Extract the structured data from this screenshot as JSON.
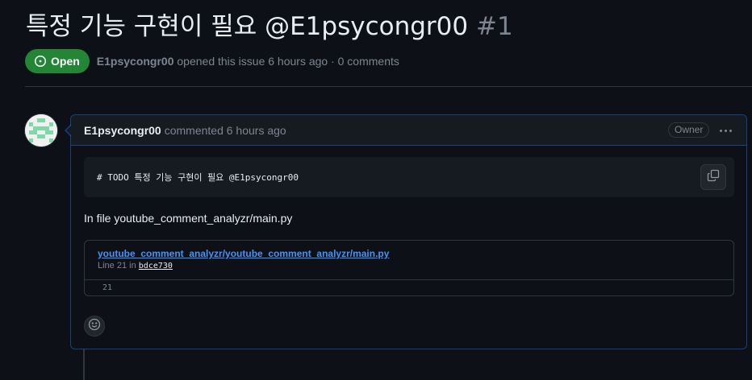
{
  "issue": {
    "title": "특정 기능 구현이 필요 @E1psycongr00",
    "number": "#1",
    "state": "Open",
    "author": "E1psycongr00",
    "meta_rest": "opened this issue 6 hours ago · 0 comments"
  },
  "comment": {
    "author": "E1psycongr00",
    "time_text": "commented 6 hours ago",
    "badge": "Owner",
    "menu_icon": "kebab-horizontal-icon",
    "code": "# TODO 특정 기능 구현이 필요 @E1psycongr00",
    "copy_icon": "copy-icon",
    "paragraph": "In file youtube_comment_analyzr/main.py",
    "permalink": {
      "path": "youtube_comment_analyzr/youtube_comment_analyzr/main.py",
      "line_prefix": "Line 21 in",
      "commit": "bdce730",
      "line_number": "21"
    },
    "reaction_icon": "smiley-icon"
  },
  "colors": {
    "background": "#0d1117",
    "open_badge": "#238636",
    "link": "#4493f8",
    "border_highlight": "#1f6feb"
  }
}
